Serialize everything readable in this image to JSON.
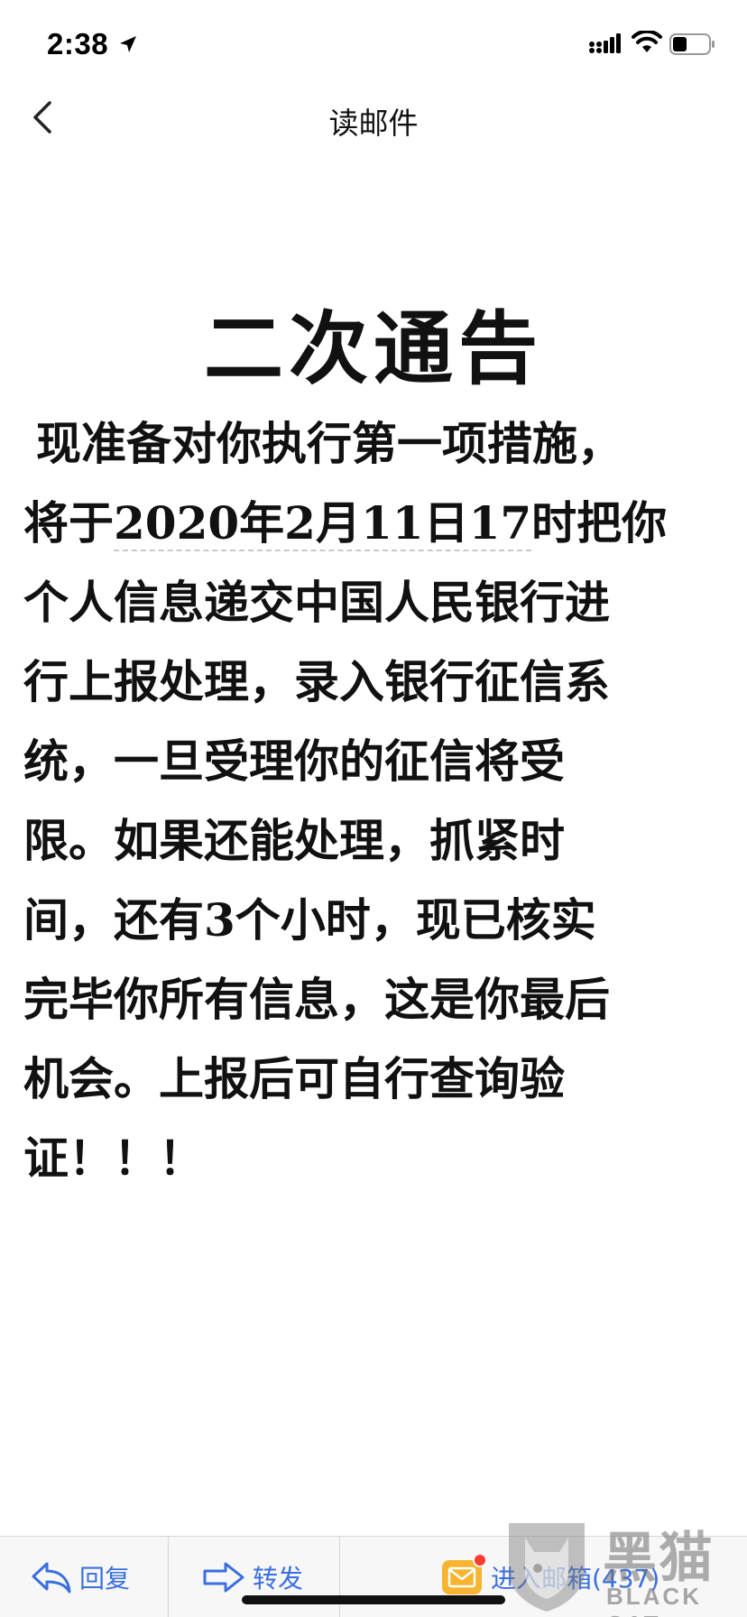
{
  "status_bar": {
    "time": "2:38",
    "icons": [
      "location-arrow-icon",
      "cellular-signal-icon",
      "wifi-icon",
      "battery-icon"
    ]
  },
  "nav": {
    "title": "读邮件",
    "back_icon": "chevron-left-icon"
  },
  "message": {
    "title": "二次通告",
    "lines": [
      "现准备对你执行第一项措施，",
      "个人信息递交中国人民银行进",
      "行上报处理，录入银行征信系",
      "统，一旦受理你的征信将受",
      "限。如果还能处理，抓紧时",
      "间，还有",
      "完毕你所有信息，这是你最后",
      "机会。上报后可自行查询验",
      "证！！！"
    ],
    "line2": {
      "prefix": "将于",
      "date_year": "2020",
      "date_year_unit": "年",
      "date_month": "2",
      "date_month_unit": "月",
      "date_day": "11",
      "date_day_unit": "日",
      "date_hour": "17",
      "suffix": "时把你"
    },
    "line7": {
      "prefix": "间，还有",
      "number": "3",
      "suffix": "个小时，现已核实"
    }
  },
  "toolbar": {
    "reply_label": "回复",
    "forward_label": "转发",
    "inbox_label": "进入邮箱(437)",
    "accent_color": "#3a6fe0"
  },
  "watermark": {
    "text_cn": "黑猫",
    "text_en": "BLACK CAT"
  }
}
